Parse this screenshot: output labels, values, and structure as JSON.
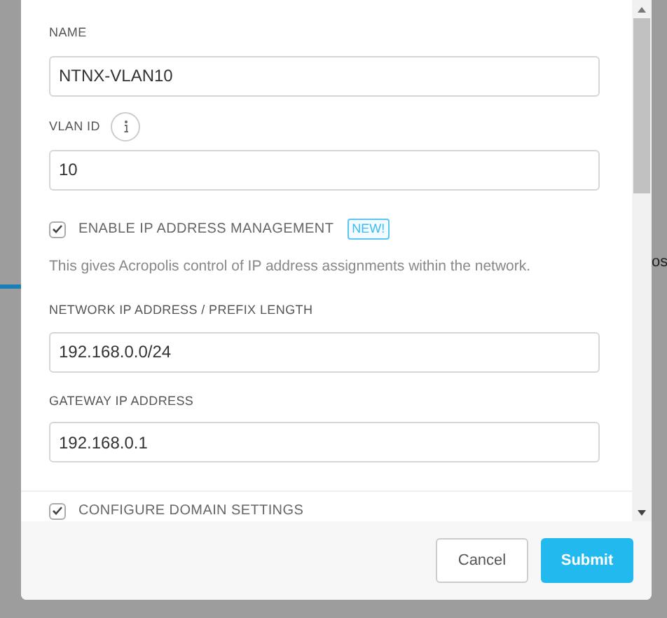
{
  "background": {
    "edge_text": "os"
  },
  "form": {
    "fields": [
      {
        "label": "NAME",
        "value": "NTNX-VLAN10",
        "info": false
      },
      {
        "label": "VLAN ID",
        "value": "10",
        "info": true
      }
    ],
    "ip_management": {
      "label": "ENABLE IP ADDRESS MANAGEMENT",
      "checked": true,
      "badge": "NEW!",
      "description": "This gives Acropolis control of IP address assignments within the network."
    },
    "ip_fields": [
      {
        "label": "NETWORK IP ADDRESS / PREFIX LENGTH",
        "value": "192.168.0.0/24"
      },
      {
        "label": "GATEWAY IP ADDRESS",
        "value": "192.168.0.1"
      }
    ],
    "domain_settings": {
      "label": "CONFIGURE DOMAIN SETTINGS",
      "checked": true
    }
  },
  "buttons": [
    {
      "label": "Cancel",
      "kind": "secondary"
    },
    {
      "label": "Submit",
      "kind": "primary"
    }
  ]
}
